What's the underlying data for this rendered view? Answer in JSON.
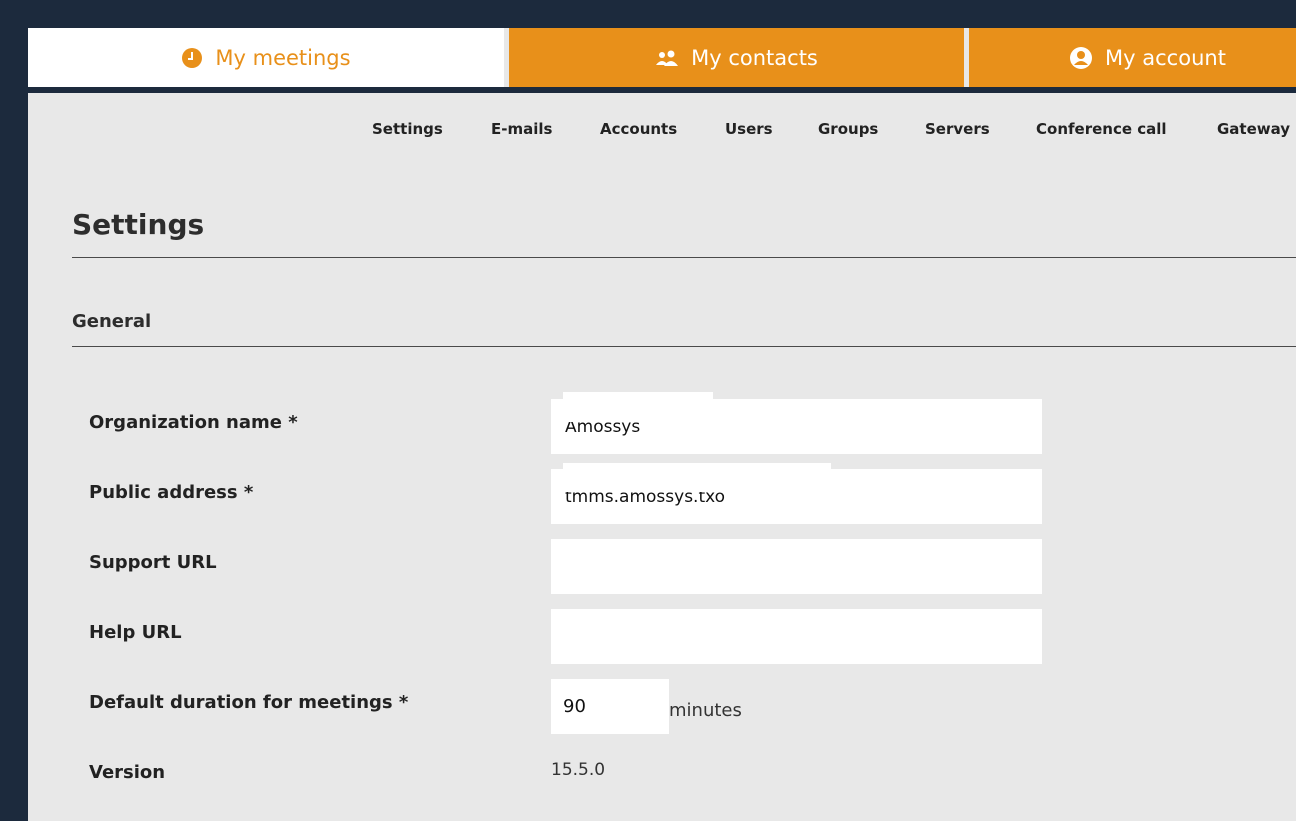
{
  "tabs": [
    {
      "label": "My meetings",
      "icon": "clock-icon"
    },
    {
      "label": "My contacts",
      "icon": "users-icon"
    },
    {
      "label": "My account",
      "icon": "user-circle-icon"
    }
  ],
  "subnav": [
    "Settings",
    "E-mails",
    "Accounts",
    "Users",
    "Groups",
    "Servers",
    "Conference call",
    "Gateway"
  ],
  "page": {
    "title": "Settings",
    "section": "General"
  },
  "form": {
    "organization_name": {
      "label": "Organization name *",
      "value": "Amossys"
    },
    "public_address": {
      "label": "Public address *",
      "value": "tmms.amossys.txo"
    },
    "support_url": {
      "label": "Support URL",
      "value": ""
    },
    "help_url": {
      "label": "Help URL",
      "value": ""
    },
    "default_duration": {
      "label": "Default duration for meetings *",
      "value": "90",
      "suffix": "minutes"
    },
    "version": {
      "label": "Version",
      "value": "15.5.0"
    }
  },
  "colors": {
    "accent": "#e8901a",
    "background": "#e8e8e8",
    "frame": "#1c2a3d"
  }
}
